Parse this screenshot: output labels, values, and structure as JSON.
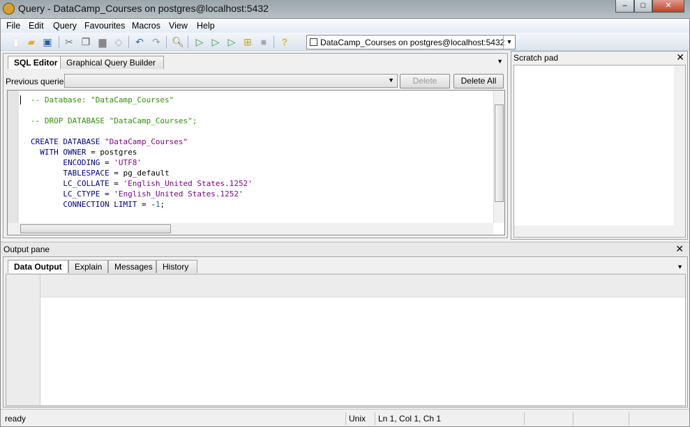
{
  "window": {
    "title": "Query - DataCamp_Courses on postgres@localhost:5432",
    "min": "–",
    "max": "□",
    "close": "✕"
  },
  "menu": [
    "File",
    "Edit",
    "Query",
    "Favourites",
    "Macros",
    "View",
    "Help"
  ],
  "toolbar": {
    "connection": "DataCamp_Courses on postgres@localhost:5432"
  },
  "editor": {
    "tabs": [
      "SQL Editor",
      "Graphical Query Builder"
    ],
    "previous_label": "Previous queries",
    "delete": "Delete",
    "delete_all": "Delete All",
    "lines": [
      [
        [
          "c",
          "-- Database: \"DataCamp_Courses\""
        ]
      ],
      [],
      [
        [
          "c",
          "-- DROP DATABASE \"DataCamp_Courses\";"
        ]
      ],
      [],
      [
        [
          "k",
          "CREATE DATABASE "
        ],
        [
          "s",
          "\"DataCamp_Courses\""
        ]
      ],
      [
        [
          "k",
          "  WITH OWNER "
        ],
        [
          "p",
          "= postgres"
        ]
      ],
      [
        [
          "k",
          "       ENCODING "
        ],
        [
          "p",
          "= "
        ],
        [
          "s",
          "'UTF8'"
        ]
      ],
      [
        [
          "k",
          "       TABLESPACE "
        ],
        [
          "p",
          "= pg_default"
        ]
      ],
      [
        [
          "k",
          "       LC_COLLATE "
        ],
        [
          "p",
          "= "
        ],
        [
          "s",
          "'English_United States.1252'"
        ]
      ],
      [
        [
          "k",
          "       LC_CTYPE "
        ],
        [
          "p",
          "= "
        ],
        [
          "s",
          "'English_United States.1252'"
        ]
      ],
      [
        [
          "k",
          "       CONNECTION LIMIT "
        ],
        [
          "p",
          "= -"
        ],
        [
          "n",
          "1"
        ],
        [
          "p",
          ";"
        ]
      ]
    ]
  },
  "scratch": {
    "title": "Scratch pad"
  },
  "output": {
    "title": "Output pane",
    "tabs": [
      "Data Output",
      "Explain",
      "Messages",
      "History"
    ]
  },
  "status": {
    "state": "ready",
    "eol": "Unix",
    "position": "Ln 1, Col 1, Ch 1"
  }
}
